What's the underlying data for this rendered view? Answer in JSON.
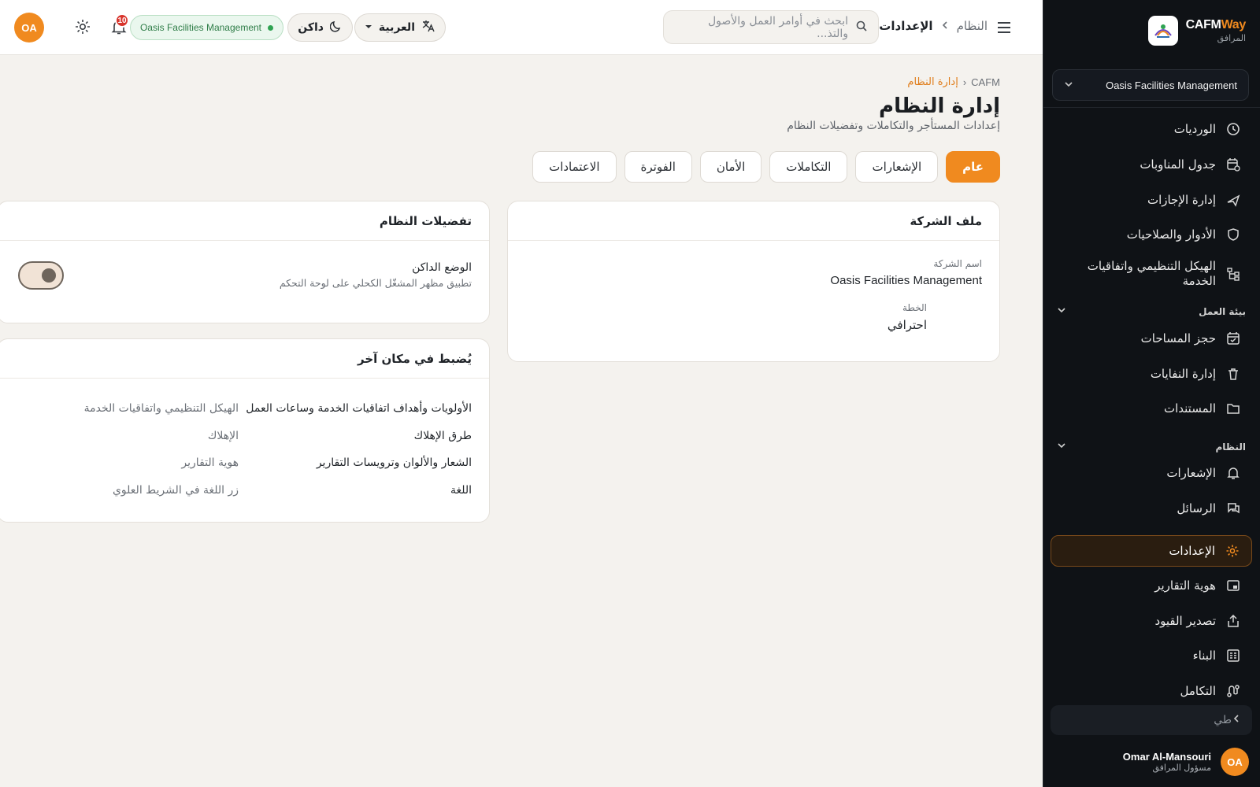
{
  "sidebar": {
    "brand_main": "CAFM",
    "brand_accent": "Way",
    "brand_sub": "المرافق",
    "tenant": "Oasis Facilities Management",
    "items": [
      {
        "label": "الورديات",
        "icon": "clock-icon"
      },
      {
        "label": "جدول المناوبات",
        "icon": "calendar-clock-icon"
      },
      {
        "label": "إدارة الإجازات",
        "icon": "plane-icon"
      },
      {
        "label": "الأدوار والصلاحيات",
        "icon": "shield-icon"
      },
      {
        "label": "الهيكل التنظيمي واتفاقيات الخدمة",
        "icon": "org-chart-icon"
      },
      {
        "label": "حجز المساحات",
        "icon": "calendar-check-icon"
      },
      {
        "label": "إدارة النفايات",
        "icon": "trash-icon"
      },
      {
        "label": "المستندات",
        "icon": "folder-icon"
      },
      {
        "label": "الإشعارات",
        "icon": "bell-icon"
      },
      {
        "label": "الرسائل",
        "icon": "chat-icon"
      },
      {
        "label": "الإعدادات",
        "icon": "gear-icon"
      },
      {
        "label": "هوية التقارير",
        "icon": "layout-icon"
      },
      {
        "label": "تصدير القيود",
        "icon": "share-icon"
      },
      {
        "label": "البناء",
        "icon": "building-icon"
      },
      {
        "label": "التكامل",
        "icon": "route-icon"
      }
    ],
    "sections": {
      "work_env": "بيئة العمل",
      "system": "النظام"
    },
    "collapse_label": "طي",
    "user": {
      "initials": "OA",
      "name": "Omar Al-Mansouri",
      "role": "مسؤول المرافق"
    }
  },
  "topbar": {
    "crumb_parent": "النظام",
    "crumb_current": "الإعدادات",
    "search_placeholder": "ابحث في أوامر العمل والأصول والتذ...",
    "language": "العربية",
    "theme": "داكن",
    "tenant_pill": "Oasis Facilities Management",
    "notif_count": "10",
    "avatar_initials": "OA"
  },
  "page": {
    "crumb_root": "CAFM",
    "crumb_current": "إدارة النظام",
    "title": "إدارة النظام",
    "subtitle": "إعدادات المستأجر والتكاملات وتفضيلات النظام",
    "tabs": [
      "عام",
      "الإشعارات",
      "التكاملات",
      "الأمان",
      "الفوترة",
      "الاعتمادات"
    ]
  },
  "company_card": {
    "title": "ملف الشركة",
    "name_label": "اسم الشركة",
    "name_value": "Oasis Facilities Management",
    "plan_label": "الخطة",
    "plan_value": "احترافي"
  },
  "prefs_card": {
    "title": "تفضيلات النظام",
    "dark_title": "الوضع الداكن",
    "dark_desc": "تطبيق مظهر المشغّل الكحلي على لوحة التحكم",
    "dark_enabled": false
  },
  "elsewhere_card": {
    "title": "يُضبط في مكان آخر",
    "rows": [
      {
        "k": "الأولويات وأهداف اتفاقيات الخدمة وساعات العمل",
        "v": "الهيكل التنظيمي واتفاقيات الخدمة"
      },
      {
        "k": "طرق الإهلاك",
        "v": "الإهلاك"
      },
      {
        "k": "الشعار والألوان وترويسات التقارير",
        "v": "هوية التقارير"
      },
      {
        "k": "اللغة",
        "v": "زر اللغة في الشريط العلوي"
      }
    ]
  },
  "colors": {
    "accent": "#f08a1f",
    "sidebar_bg": "#0f1216",
    "page_bg": "#f4f2ee",
    "success": "#2fa352",
    "danger": "#d8342c"
  }
}
